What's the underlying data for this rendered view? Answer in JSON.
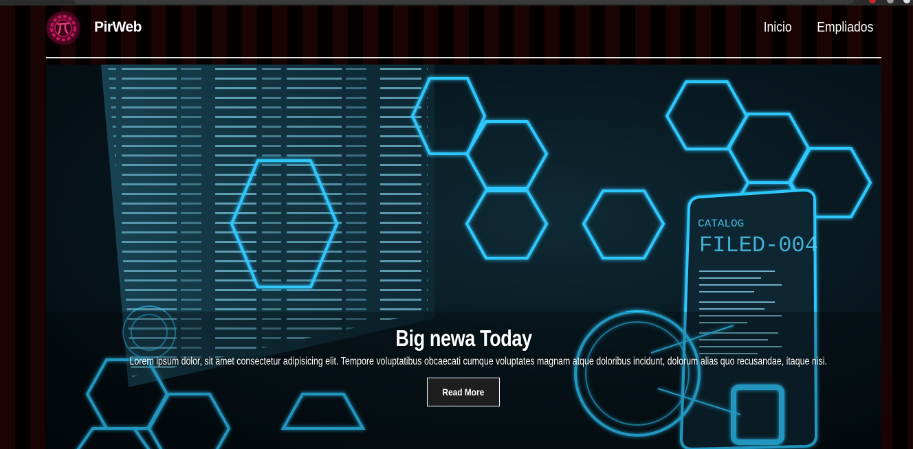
{
  "brand": {
    "name": "PirWeb",
    "logo_icon": "pi-gear-logo-icon"
  },
  "nav": {
    "links": [
      {
        "label": "Inicio"
      },
      {
        "label": "Empliados"
      }
    ]
  },
  "hero": {
    "title": "Big newa Today",
    "text": "Lorem ipsum dolor, sit amet consectetur adipisicing elit. Tempore voluptatibus obcaecati cumque voluptates magnam atque doloribus incidunt, dolorum alias quo recusandae, itaque nisi.",
    "button_label": "Read More",
    "image_text": {
      "catalog": "CATALOG",
      "filed": "FILED-004"
    }
  },
  "colors": {
    "accent_cyan": "#2fc8ff",
    "logo_magenta": "#c2185b",
    "stripe_dark_red": "#1a0303"
  }
}
